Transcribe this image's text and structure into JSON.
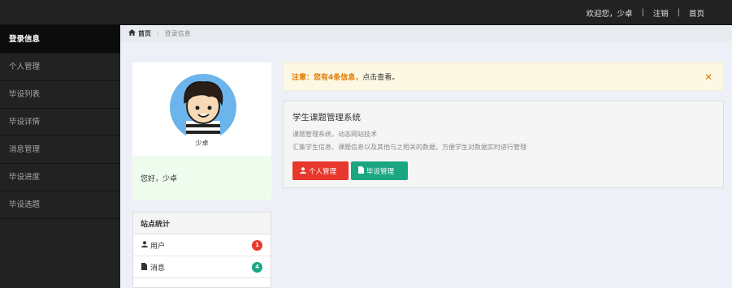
{
  "topnav": {
    "welcome": "欢迎您，少卓",
    "logout": "注销",
    "home": "首页"
  },
  "sidebar": {
    "items": [
      {
        "label": "登录信息",
        "active": true
      },
      {
        "label": "个人管理"
      },
      {
        "label": "毕设列表"
      },
      {
        "label": "毕设详情"
      },
      {
        "label": "消息管理"
      },
      {
        "label": "毕设进度"
      },
      {
        "label": "毕设选题"
      }
    ]
  },
  "breadcrumb": {
    "home": "首页",
    "current": "登录信息"
  },
  "profile": {
    "name": "少卓",
    "greeting": "您好，少卓"
  },
  "stats": {
    "title": "站点统计",
    "rows": [
      {
        "label": "用户",
        "count": "1",
        "color": "#e8372c",
        "icon": "user-icon"
      },
      {
        "label": "消息",
        "count": "4",
        "color": "#1aa681",
        "icon": "file-icon"
      }
    ]
  },
  "alert": {
    "prefix": "注意：您有4条信息，",
    "suffix": "点击查看。",
    "close": "✕"
  },
  "card": {
    "title": "学生课题管理系统",
    "desc1": "课题管理系统，动态网站技术",
    "desc2": "汇集学生信息、课题信息以及其他与之相关的数据，方便学生对数据实时进行管理",
    "btn_personal": "个人管理",
    "btn_project": "毕设管理"
  },
  "colors": {
    "topbar": "#222222",
    "sidebar_active": "#0c0c0c",
    "content_bg": "#edf1f7",
    "danger": "#e8372c",
    "success": "#1aa681",
    "warning_text": "#e07b00"
  }
}
